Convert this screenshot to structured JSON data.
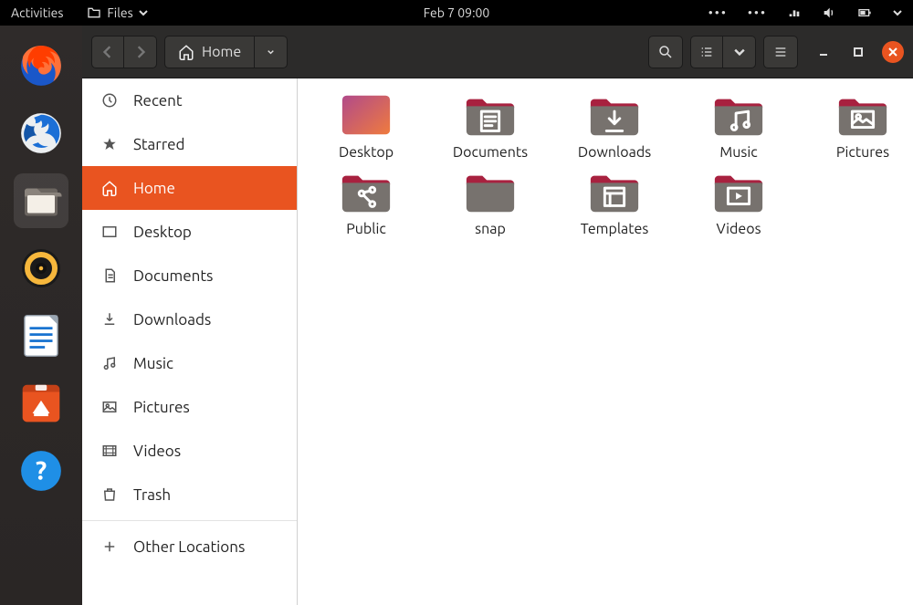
{
  "topbar": {
    "activities": "Activities",
    "app_label": "Files",
    "clock": "Feb 7  09:00"
  },
  "headerbar": {
    "location_label": "Home"
  },
  "sidebar": {
    "items": [
      {
        "label": "Recent"
      },
      {
        "label": "Starred"
      },
      {
        "label": "Home"
      },
      {
        "label": "Desktop"
      },
      {
        "label": "Documents"
      },
      {
        "label": "Downloads"
      },
      {
        "label": "Music"
      },
      {
        "label": "Pictures"
      },
      {
        "label": "Videos"
      },
      {
        "label": "Trash"
      }
    ],
    "other_locations": "Other Locations"
  },
  "content": {
    "items": [
      {
        "label": "Desktop",
        "icon": "desktop"
      },
      {
        "label": "Documents",
        "icon": "documents"
      },
      {
        "label": "Downloads",
        "icon": "downloads"
      },
      {
        "label": "Music",
        "icon": "music"
      },
      {
        "label": "Pictures",
        "icon": "pictures"
      },
      {
        "label": "Public",
        "icon": "public"
      },
      {
        "label": "snap",
        "icon": "plain"
      },
      {
        "label": "Templates",
        "icon": "templates"
      },
      {
        "label": "Videos",
        "icon": "videos"
      }
    ]
  }
}
